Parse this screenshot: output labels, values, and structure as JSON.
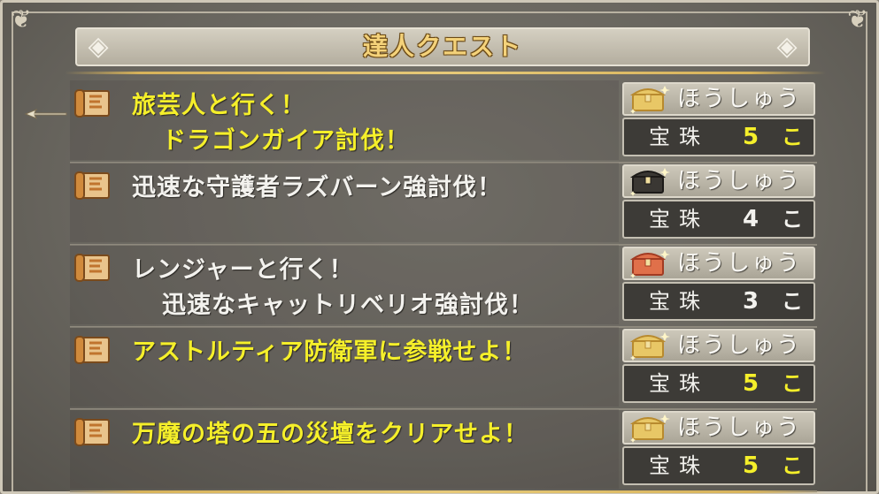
{
  "window": {
    "title": "達人クエスト"
  },
  "quests": [
    {
      "lines": [
        "旅芸人と行く！",
        "ドラゴンガイア討伐！"
      ],
      "text_color": "#f5ef2a",
      "highlighted": true,
      "reward": {
        "header": "ほうしゅう",
        "item": "宝珠",
        "qty": "5",
        "unit": "こ",
        "chest": "gold-chest-icon",
        "qty_color": "#f5ef2a"
      }
    },
    {
      "lines": [
        "迅速な守護者ラズバーン強討伐！"
      ],
      "text_color": "#f3f2ee",
      "highlighted": false,
      "reward": {
        "header": "ほうしゅう",
        "item": "宝珠",
        "qty": "4",
        "unit": "こ",
        "chest": "black-chest-icon",
        "qty_color": "#f3f2ee"
      }
    },
    {
      "lines": [
        "レンジャーと行く！",
        "迅速なキャットリベリオ強討伐！"
      ],
      "text_color": "#f3f2ee",
      "highlighted": false,
      "reward": {
        "header": "ほうしゅう",
        "item": "宝珠",
        "qty": "3",
        "unit": "こ",
        "chest": "red-chest-icon",
        "qty_color": "#f3f2ee"
      }
    },
    {
      "lines": [
        "アストルティア防衛軍に参戦せよ！"
      ],
      "text_color": "#f5ef2a",
      "highlighted": false,
      "reward": {
        "header": "ほうしゅう",
        "item": "宝珠",
        "qty": "5",
        "unit": "こ",
        "chest": "gold-chest-icon",
        "qty_color": "#f5ef2a"
      }
    },
    {
      "lines": [
        "万魔の塔の五の災壇をクリアせよ！"
      ],
      "text_color": "#f5ef2a",
      "highlighted": false,
      "reward": {
        "header": "ほうしゅう",
        "item": "宝珠",
        "qty": "5",
        "unit": "こ",
        "chest": "gold-chest-icon",
        "qty_color": "#f5ef2a"
      }
    }
  ]
}
